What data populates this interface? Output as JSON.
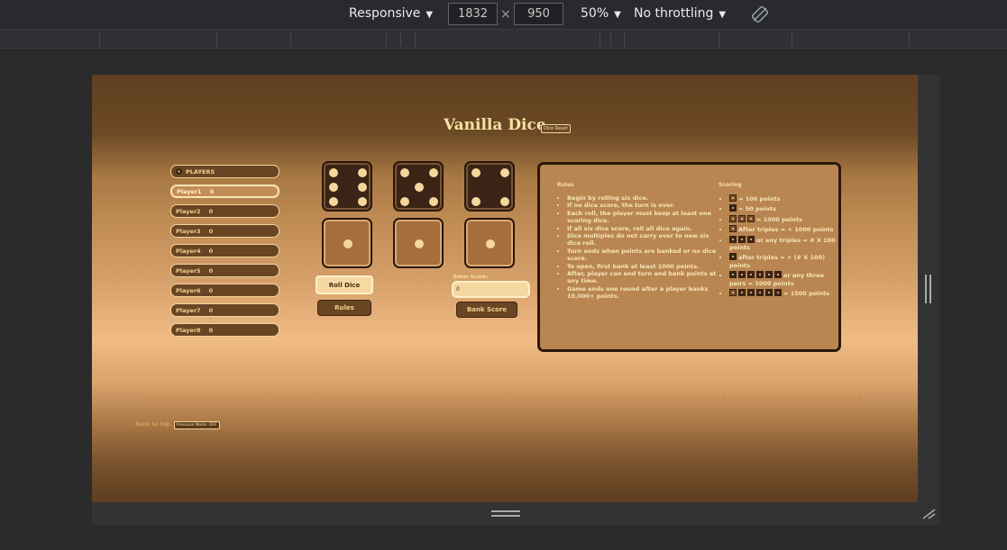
{
  "devtools": {
    "device": "Responsive",
    "width": "1832",
    "height": "950",
    "times": "×",
    "zoom": "50%",
    "throttle": "No throttling"
  },
  "page": {
    "title": "Vanilla Dice",
    "dice_reset": "Dice Reset",
    "players_header": "PLAYERS",
    "players": [
      {
        "name": "Player1",
        "score": "0"
      },
      {
        "name": "Player2",
        "score": "0"
      },
      {
        "name": "Player3",
        "score": "0"
      },
      {
        "name": "Player4",
        "score": "0"
      },
      {
        "name": "Player5",
        "score": "0"
      },
      {
        "name": "Player6",
        "score": "0"
      },
      {
        "name": "Player7",
        "score": "0"
      },
      {
        "name": "Player8",
        "score": "0"
      }
    ],
    "dice_top": [
      6,
      5,
      4
    ],
    "dice_bottom": [
      1,
      1,
      1
    ],
    "roll_dice": "Roll Dice",
    "rules_button": "Rules",
    "enter_score_label": "Enter Score:",
    "enter_score_value": "0",
    "bank_score": "Bank Score",
    "rules_heading": "Rules",
    "scoring_heading": "Scoring",
    "rules": [
      "Begin by rolling six dice.",
      "If no dice score, the turn is over.",
      "Each roll, the player must keep at least one scoring dice.",
      "If all six dice score, roll all dice again.",
      "Dice multiples do not carry over to new six dice roll.",
      "Turn ends when points are banked or no dice score.",
      "To open, first bank at least 1000 points.",
      "After, player can end turn and bank points at any time.",
      "Game ends one round after a player banks 10,000+ points."
    ],
    "scoring": [
      "= 100 points",
      "= 50 points",
      "= 1000 points",
      "After triples = + 1000 points",
      "or any triples = # X 100 points",
      "after triples = + (# X 100) points",
      "or any three pairs = 1000 points",
      "= 1500 points"
    ],
    "lyric": "IF THERE WAS A PROBLEM, YO, I'LL SOLVE IT. CHECK OUT THE HOOK WHILE MY DJ REVOLVES IT . ICE, ICE BABY,VANILLA ICE, ICE BABY,VANILLA ICE, ICE BABY,VANILLA ICE, ICE BABY,VANILLA",
    "back_to_top": "Back to top",
    "pressure_mode": "Pressure Mode: OFF"
  },
  "colors": {
    "accent": "#f7e0a5",
    "die_dark": "#3b2415",
    "die_light": "#a56e3d"
  }
}
